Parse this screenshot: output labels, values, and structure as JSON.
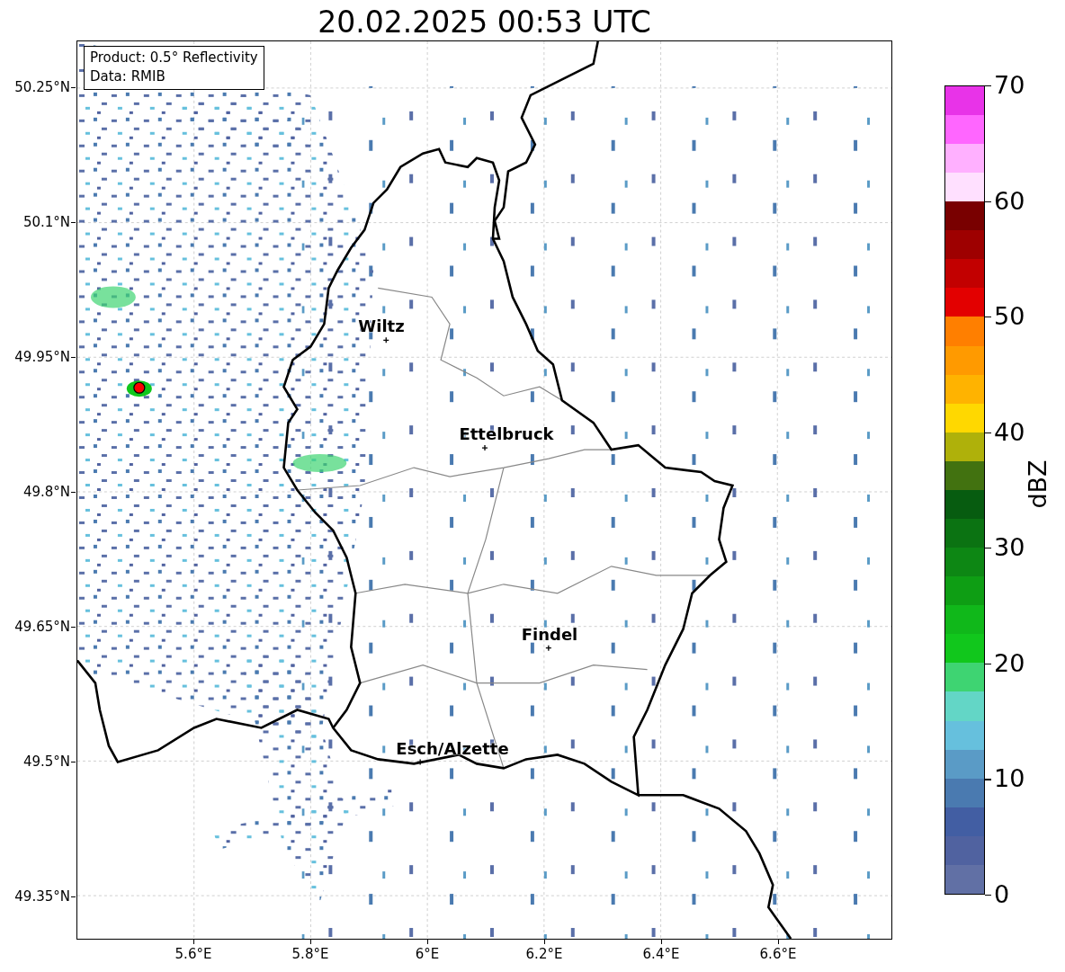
{
  "title": "20.02.2025 00:53 UTC",
  "info_box": [
    "Product: 0.5° Reflectivity",
    "Data: RMIB"
  ],
  "cities": [
    {
      "name": "Wiltz"
    },
    {
      "name": "Ettelbruck"
    },
    {
      "name": "Findel"
    },
    {
      "name": "Esch/Alzette"
    }
  ],
  "x_axis_labels": [
    "5.6°E",
    "5.8°E",
    "6°E",
    "6.2°E",
    "6.4°E",
    "6.6°E"
  ],
  "y_axis_labels": [
    "50.25°N",
    "50.1°N",
    "49.95°N",
    "49.8°N",
    "49.65°N",
    "49.5°N",
    "49.35°N"
  ],
  "colorbar": {
    "label": "dBZ",
    "ticks": [
      "70",
      "60",
      "50",
      "40",
      "30",
      "20",
      "10",
      "0"
    ],
    "segments": [
      {
        "color": "#6170a5"
      },
      {
        "color": "#5062a0"
      },
      {
        "color": "#425ea3"
      },
      {
        "color": "#4a7ab0"
      },
      {
        "color": "#5a9bc6"
      },
      {
        "color": "#66c0dd"
      },
      {
        "color": "#63d6c6"
      },
      {
        "color": "#3ed472"
      },
      {
        "color": "#11c71c"
      },
      {
        "color": "#10b81a"
      },
      {
        "color": "#0e9e14"
      },
      {
        "color": "#0d8714"
      },
      {
        "color": "#0b7312"
      },
      {
        "color": "#075c10"
      },
      {
        "color": "#427210"
      },
      {
        "color": "#afb10a"
      },
      {
        "color": "#ffd800"
      },
      {
        "color": "#ffb300"
      },
      {
        "color": "#ff9a00"
      },
      {
        "color": "#ff7f00"
      },
      {
        "color": "#e30000"
      },
      {
        "color": "#c20000"
      },
      {
        "color": "#9e0000"
      },
      {
        "color": "#790000"
      },
      {
        "color": "#ffe0ff"
      },
      {
        "color": "#ffb0ff"
      },
      {
        "color": "#ff66ff"
      },
      {
        "color": "#e833e8"
      }
    ]
  }
}
